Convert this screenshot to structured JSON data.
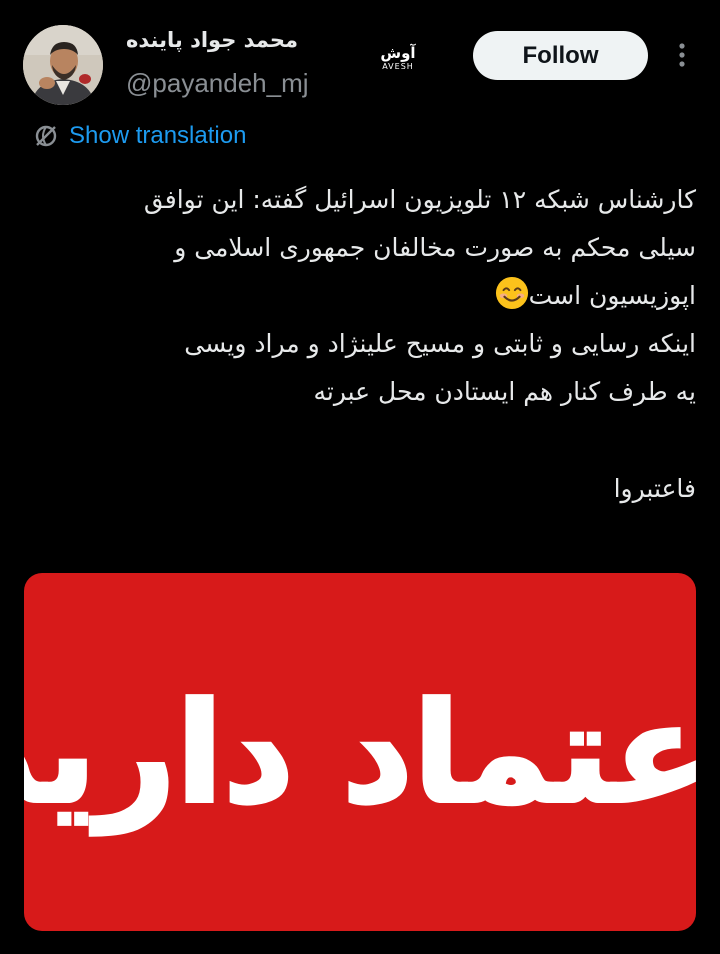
{
  "author": {
    "display_name": "محمد جواد پاینده",
    "handle": "@payandeh_mj",
    "avatar_icon": "person-photo-avatar"
  },
  "affiliate_badge": {
    "text_fa": "آوش",
    "text_en": "AVESH"
  },
  "follow_label": "Follow",
  "more_icon": "more-vertical-icon",
  "translation": {
    "icon": "globe-translate-icon",
    "label": "Show translation"
  },
  "tweet": {
    "lines": [
      "کارشناس شبکه ۱۲ تلویزیون اسرائیل گفته: این توافق",
      "سیلی محکم به صورت مخالفان جمهوری اسلامی و",
      "اپوزیسیون است",
      "اینکه رسایی و ثابتی و مسیح علینژاد و مراد ویسی",
      "یه طرف کنار هم ایستادن محل عبرته",
      "",
      "فاعتبروا"
    ],
    "emoji": "smiling-face-emoji"
  },
  "media": {
    "text": "اعتماد دارید",
    "background": "#d71a1a",
    "text_color": "#ffffff"
  },
  "colors": {
    "background": "#000000",
    "text": "#e7e9ea",
    "handle": "#8a8f94",
    "link": "#1d9bf0",
    "button_bg": "#eff3f4"
  }
}
